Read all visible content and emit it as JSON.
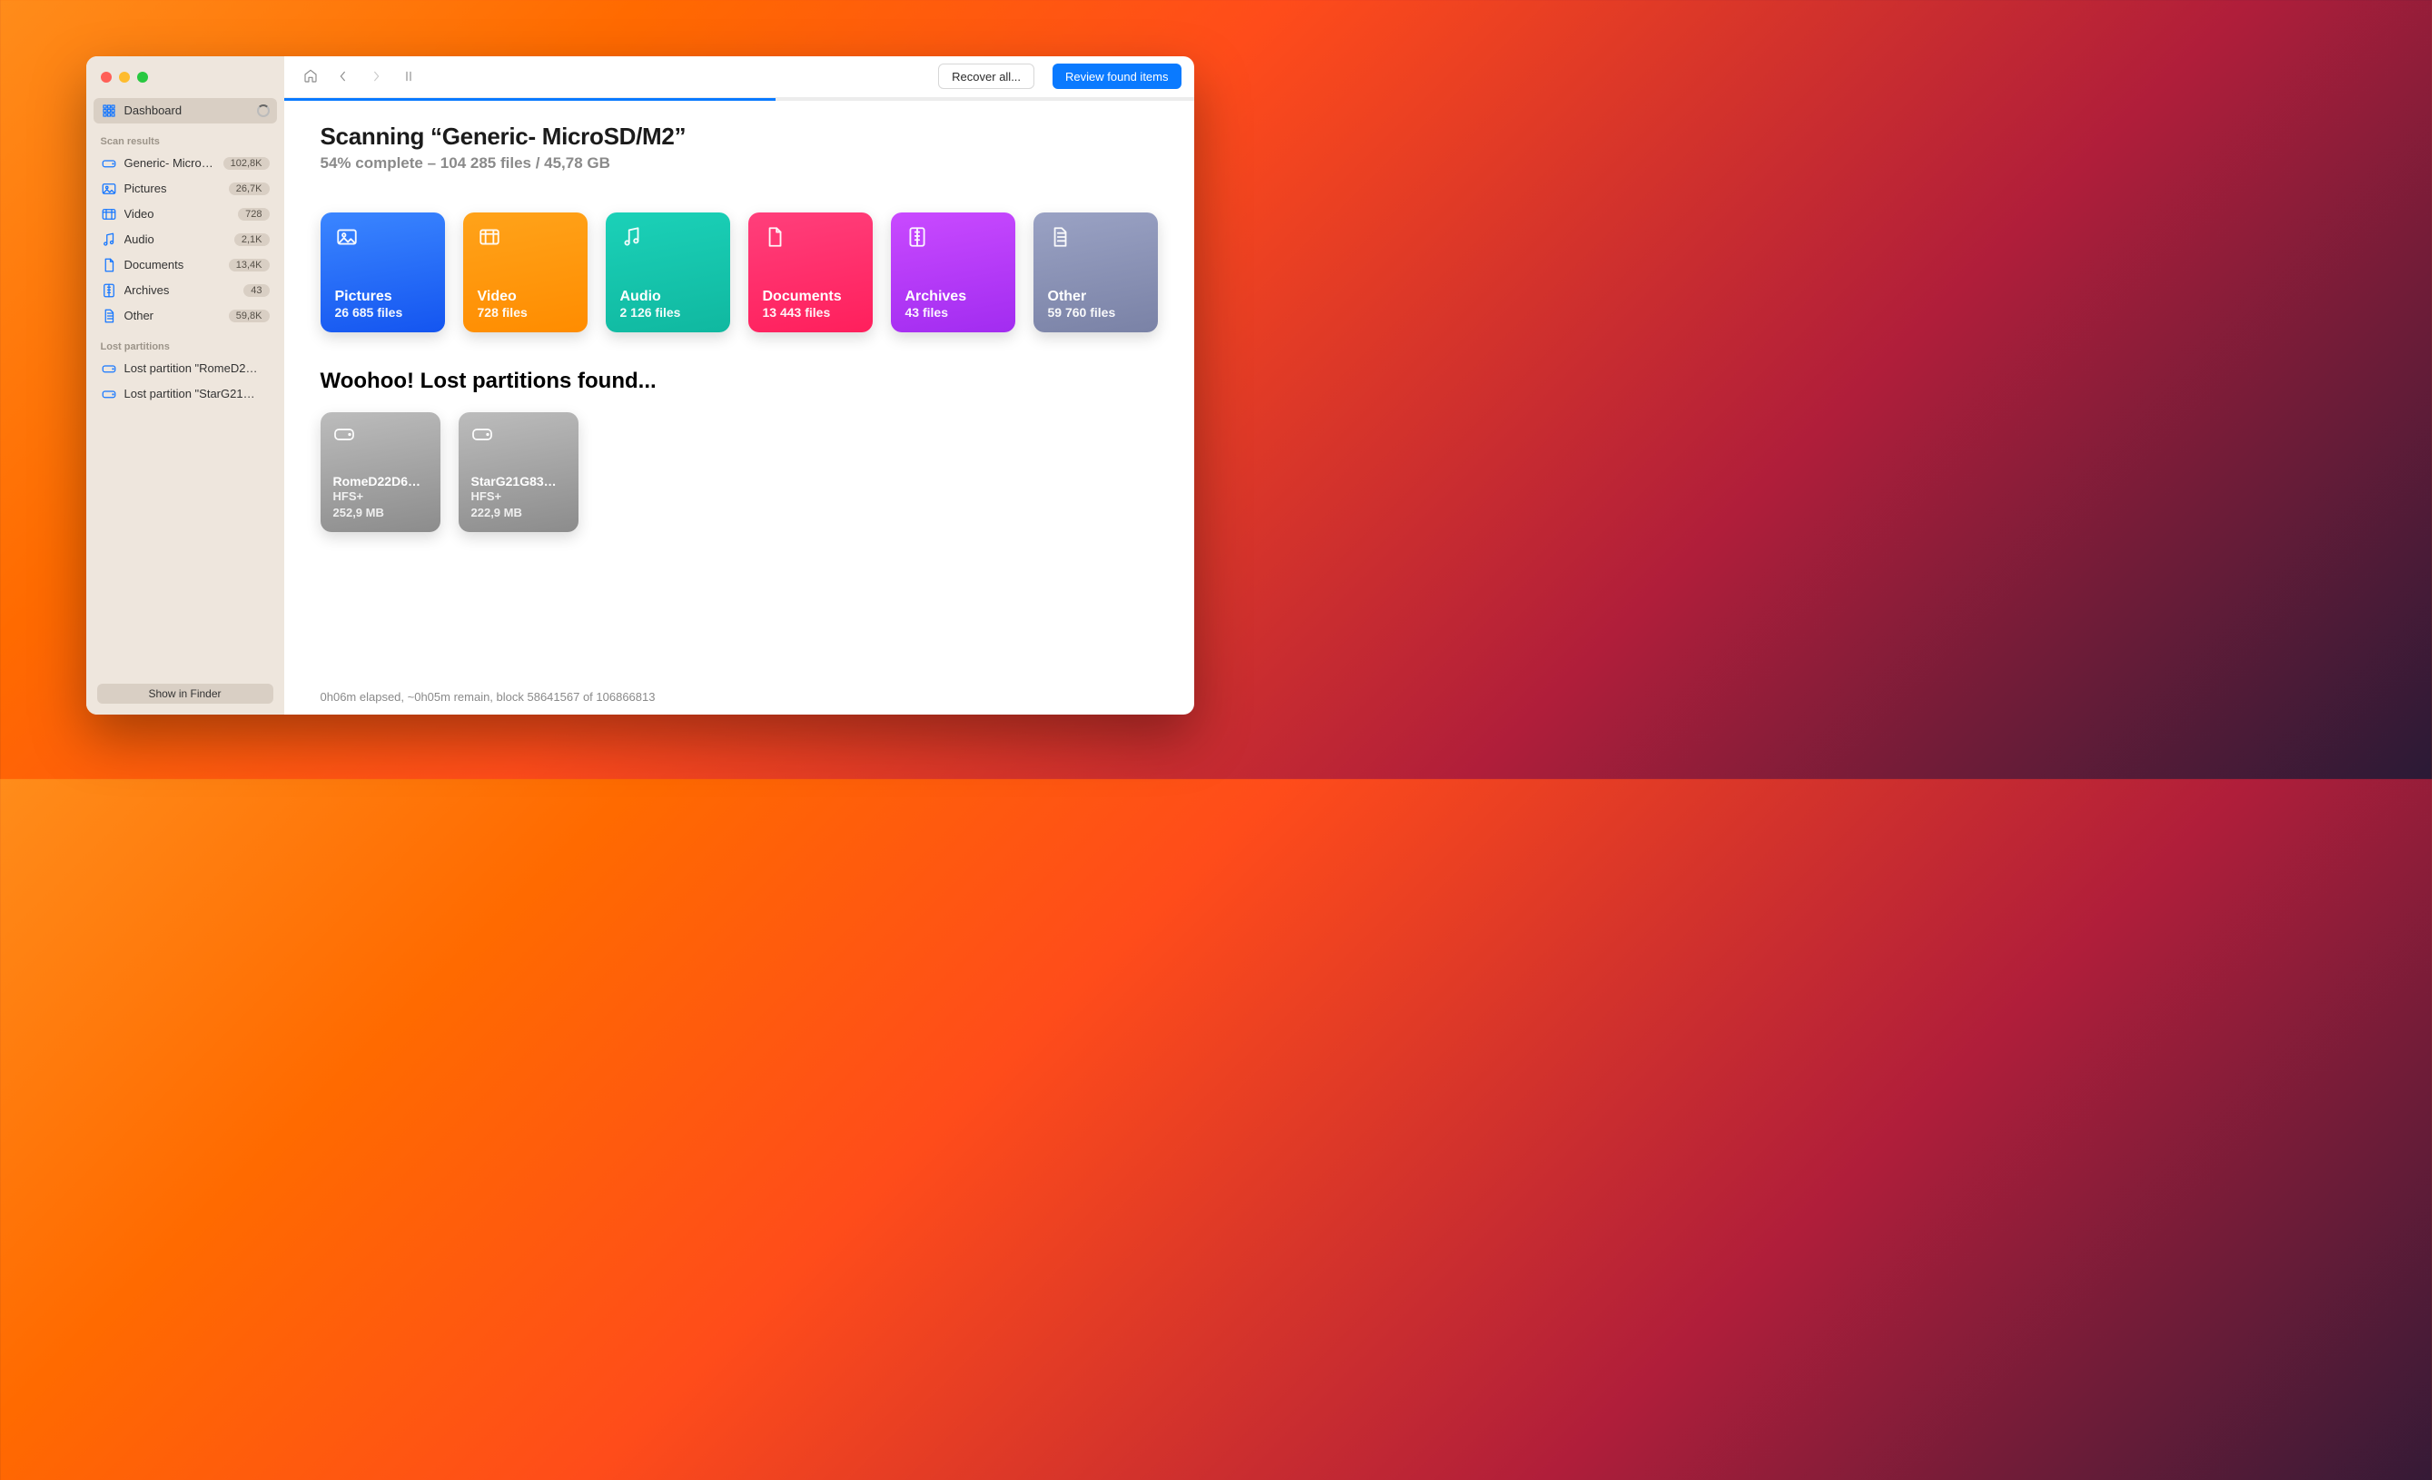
{
  "sidebar": {
    "dashboard_label": "Dashboard",
    "section_results": "Scan results",
    "section_lost": "Lost partitions",
    "results": [
      {
        "label": "Generic- MicroS…",
        "badge": "102,8K",
        "icon": "drive"
      },
      {
        "label": "Pictures",
        "badge": "26,7K",
        "icon": "image"
      },
      {
        "label": "Video",
        "badge": "728",
        "icon": "video"
      },
      {
        "label": "Audio",
        "badge": "2,1K",
        "icon": "note"
      },
      {
        "label": "Documents",
        "badge": "13,4K",
        "icon": "doc"
      },
      {
        "label": "Archives",
        "badge": "43",
        "icon": "zip"
      },
      {
        "label": "Other",
        "badge": "59,8K",
        "icon": "file"
      }
    ],
    "lost": [
      {
        "label": "Lost partition \"RomeD2…"
      },
      {
        "label": "Lost partition \"StarG21…"
      }
    ],
    "show_in_finder": "Show in Finder"
  },
  "toolbar": {
    "recover": "Recover all...",
    "review": "Review found items"
  },
  "scan": {
    "title": "Scanning “Generic- MicroSD/M2”",
    "subtitle": "54% complete – 104 285 files / 45,78 GB",
    "progress_percent": 54
  },
  "cards": [
    {
      "title": "Pictures",
      "count": "26 685 files",
      "cls": "c-pictures",
      "icon": "image"
    },
    {
      "title": "Video",
      "count": "728 files",
      "cls": "c-video",
      "icon": "video"
    },
    {
      "title": "Audio",
      "count": "2 126 files",
      "cls": "c-audio",
      "icon": "note"
    },
    {
      "title": "Documents",
      "count": "13 443 files",
      "cls": "c-documents",
      "icon": "doc"
    },
    {
      "title": "Archives",
      "count": "43 files",
      "cls": "c-archives",
      "icon": "zip"
    },
    {
      "title": "Other",
      "count": "59 760 files",
      "cls": "c-other",
      "icon": "file"
    }
  ],
  "lost_heading": "Woohoo! Lost partitions found...",
  "partitions": [
    {
      "name": "RomeD22D6…",
      "fs": "HFS+",
      "size": "252,9 MB"
    },
    {
      "name": "StarG21G83…",
      "fs": "HFS+",
      "size": "222,9 MB"
    }
  ],
  "status": "0h06m elapsed, ~0h05m remain, block 58641567 of 106866813"
}
